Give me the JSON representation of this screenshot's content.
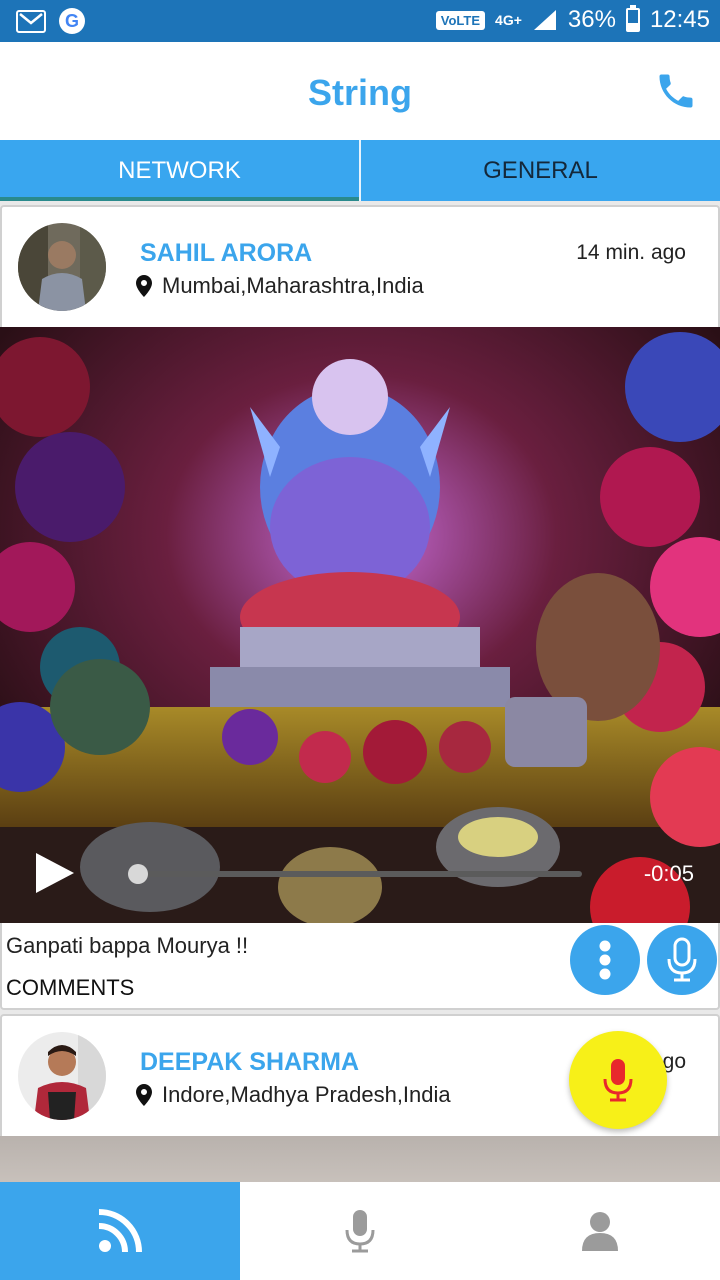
{
  "status_bar": {
    "volte": "VoLTE",
    "network": "4G+",
    "battery": "36%",
    "battery_level": 0.36,
    "time": "12:45"
  },
  "app": {
    "title": "String",
    "accent": "#3ba5ec"
  },
  "tabs": [
    {
      "label": "NETWORK",
      "active": true
    },
    {
      "label": "GENERAL",
      "active": false
    }
  ],
  "posts": [
    {
      "name": "SAHIL ARORA",
      "location": "Mumbai,Maharashtra,India",
      "time": "14 min. ago",
      "caption": "Ganpati bappa Mourya !!",
      "comments_label": "COMMENTS",
      "media": {
        "remaining": "-0:05",
        "progress": 0.0
      }
    },
    {
      "name": "DEEPAK SHARMA",
      "location": "Indore,Madhya Pradesh,India",
      "time": "go"
    }
  ],
  "icons": {
    "call": "phone-icon",
    "location": "location-pin-icon",
    "more": "more-vert-icon",
    "mic": "mic-icon",
    "feed": "feed-icon",
    "profile": "person-icon"
  },
  "bottom_nav": [
    {
      "name": "feed",
      "active": true
    },
    {
      "name": "record",
      "active": false
    },
    {
      "name": "profile",
      "active": false
    }
  ]
}
